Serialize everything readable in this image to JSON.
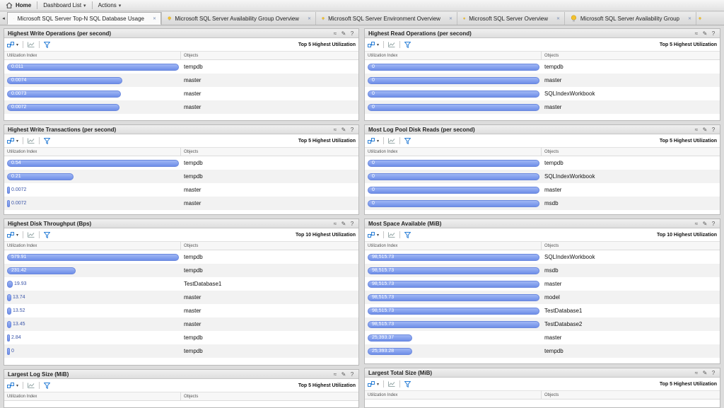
{
  "topbar": {
    "home_label": "Home",
    "dashboard_list_label": "Dashboard List",
    "actions_label": "Actions"
  },
  "tabs": [
    {
      "label": "Microsoft SQL Server Top-N SQL Database Usage",
      "active": true
    },
    {
      "label": "Microsoft SQL Server Availability Group Overview",
      "active": false
    },
    {
      "label": "Microsoft SQL Server Environment Overview",
      "active": false
    },
    {
      "label": "Microsoft SQL Server Overview",
      "active": false
    },
    {
      "label": "Microsoft SQL Server Availability Group",
      "active": false
    }
  ],
  "table_headers": {
    "index": "Utilization Index",
    "objects": "Objects"
  },
  "colors": {
    "bar": "#7b98ea",
    "bar_border": "#6a88dd",
    "accent_filter": "#2b7fd6"
  },
  "panels": {
    "write_ops": {
      "title": "Highest Write Operations (per second)",
      "toolbar_label": "Top 5 Highest Utilization",
      "max": 0.011,
      "rows": [
        {
          "value": 0.011,
          "label": "0.011",
          "object": "tempdb"
        },
        {
          "value": 0.0074,
          "label": "0.0074",
          "object": "master"
        },
        {
          "value": 0.0073,
          "label": "0.0073",
          "object": "master"
        },
        {
          "value": 0.0072,
          "label": "0.0072",
          "object": "master"
        }
      ]
    },
    "read_ops": {
      "title": "Highest Read Operations (per second)",
      "toolbar_label": "Top 5 Highest Utilization",
      "max": 0,
      "rows": [
        {
          "value": 0,
          "label": "0",
          "object": "tempdb"
        },
        {
          "value": 0,
          "label": "0",
          "object": "master"
        },
        {
          "value": 0,
          "label": "0",
          "object": "SQLIndexWorkbook"
        },
        {
          "value": 0,
          "label": "0",
          "object": "master"
        }
      ]
    },
    "write_tx": {
      "title": "Highest Write Transactions (per second)",
      "toolbar_label": "Top 5 Highest Utilization",
      "max": 0.54,
      "rows": [
        {
          "value": 0.54,
          "label": "0.54",
          "object": "tempdb"
        },
        {
          "value": 0.21,
          "label": "0.21",
          "object": "tempdb"
        },
        {
          "value": 0.0072,
          "label": "0.0072",
          "object": "master"
        },
        {
          "value": 0.0072,
          "label": "0.0072",
          "object": "master"
        }
      ]
    },
    "log_reads": {
      "title": "Most Log Pool Disk Reads (per second)",
      "toolbar_label": "Top 5 Highest Utilization",
      "max": 0,
      "rows": [
        {
          "value": 0,
          "label": "0",
          "object": "tempdb"
        },
        {
          "value": 0,
          "label": "0",
          "object": "SQLIndexWorkbook"
        },
        {
          "value": 0,
          "label": "0",
          "object": "master"
        },
        {
          "value": 0,
          "label": "0",
          "object": "msdb"
        }
      ]
    },
    "disk_throughput": {
      "title": "Highest Disk Throughput (Bps)",
      "toolbar_label": "Top 10 Highest Utilization",
      "max": 579.91,
      "rows": [
        {
          "value": 579.91,
          "label": "579.91",
          "object": "tempdb"
        },
        {
          "value": 231.42,
          "label": "231.42",
          "object": "tempdb"
        },
        {
          "value": 19.93,
          "label": "19.93",
          "object": "TestDatabase1"
        },
        {
          "value": 13.74,
          "label": "13.74",
          "object": "master"
        },
        {
          "value": 13.52,
          "label": "13.52",
          "object": "master"
        },
        {
          "value": 13.45,
          "label": "13.45",
          "object": "master"
        },
        {
          "value": 2.84,
          "label": "2.84",
          "object": "tempdb"
        },
        {
          "value": 0,
          "label": "0",
          "object": "tempdb"
        }
      ]
    },
    "space_available": {
      "title": "Most Space Available (MiB)",
      "toolbar_label": "Top 10 Highest Utilization",
      "max": 98515.73,
      "rows": [
        {
          "value": 98515.73,
          "label": "98,515.73",
          "object": "SQLIndexWorkbook"
        },
        {
          "value": 98515.73,
          "label": "98,515.73",
          "object": "msdb"
        },
        {
          "value": 98515.73,
          "label": "98,515.73",
          "object": "master"
        },
        {
          "value": 98515.73,
          "label": "98,515.73",
          "object": "model"
        },
        {
          "value": 98515.73,
          "label": "98,515.73",
          "object": "TestDatabase1"
        },
        {
          "value": 98515.73,
          "label": "98,515.73",
          "object": "TestDatabase2"
        },
        {
          "value": 25393.37,
          "label": "25,393.37",
          "object": "master"
        },
        {
          "value": 25393.28,
          "label": "25,393.28",
          "object": "tempdb"
        }
      ]
    },
    "log_size": {
      "title": "Largest Log Size (MiB)",
      "toolbar_label": "Top 5 Highest Utilization",
      "max": 1,
      "rows": []
    },
    "total_size": {
      "title": "Largest Total Size (MiB)",
      "toolbar_label": "Top 5 Highest Utilization",
      "max": 1,
      "rows": []
    }
  }
}
